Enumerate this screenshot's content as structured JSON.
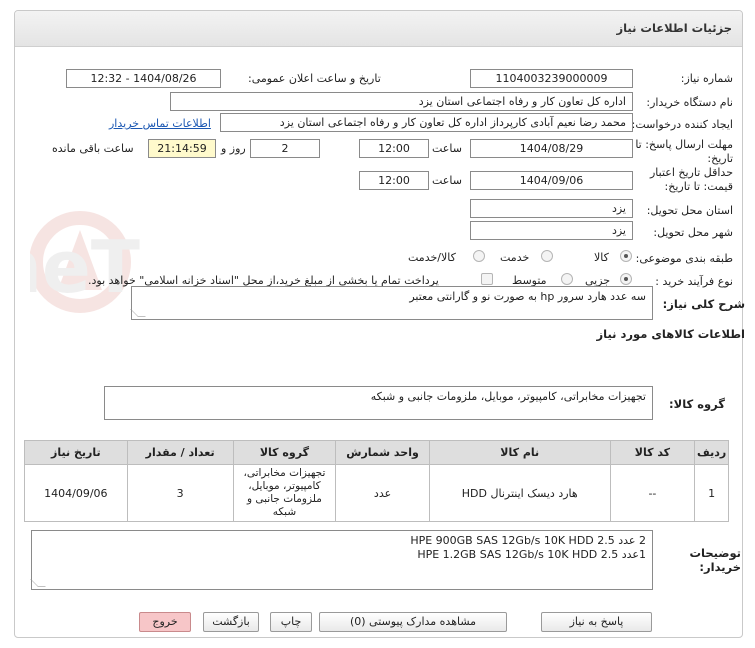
{
  "panel": {
    "title": "جزئیات اطلاعات نیاز"
  },
  "fields": {
    "need_number_label": "شماره نیاز:",
    "need_number": "1104003239000009",
    "announce_label": "تاریخ و ساعت اعلان عمومی:",
    "announce_value": "1404/08/26 - 12:32",
    "buyer_org_label": "نام دستگاه خریدار:",
    "buyer_org": "اداره کل تعاون  کار و رفاه اجتماعی استان یزد",
    "creator_label": "ایجاد کننده درخواست:",
    "creator": "محمد رضا  نعیم آبادی کارپرداز اداره کل تعاون  کار و رفاه اجتماعی استان یزد",
    "contact_link": "اطلاعات تماس خریدار",
    "deadline_label_1": "مهلت ارسال پاسخ: تا",
    "deadline_label_2": "تاریخ:",
    "deadline_date": "1404/08/29",
    "time_label": "ساعت",
    "deadline_time": "12:00",
    "days_value": "2",
    "days_label": "روز و",
    "remaining_time": "21:14:59",
    "remaining_label": "ساعت باقی مانده",
    "validity_label_1": "حداقل تاریخ اعتبار",
    "validity_label_2": "قیمت: تا تاریخ:",
    "validity_date": "1404/09/06",
    "validity_time": "12:00",
    "province_label": "استان محل تحویل:",
    "province": "یزد",
    "city_label": "شهر محل تحویل:",
    "city": "یزد",
    "category_label": "طبقه بندی موضوعی:",
    "category_options": [
      "کالا",
      "خدمت",
      "کالا/خدمت"
    ],
    "category_selected": "کالا",
    "process_label": "نوع فرآیند خرید :",
    "process_options": [
      "جزیی",
      "متوسط"
    ],
    "payment_note": "پرداخت تمام یا بخشی از مبلغ خرید،از محل \"اسناد خزانه اسلامی\" خواهد بود."
  },
  "summary": {
    "label": "شرح کلی نیاز:",
    "text": "سه عدد هارد سرور hp به صورت نو و گارانتی معتبر"
  },
  "goods": {
    "section_title": "اطلاعات کالاهای مورد نیاز",
    "group_label": "گروه کالا:",
    "group_value": "تجهیزات مخابراتی، کامپیوتر، موبایل، ملزومات جانبی و شبکه"
  },
  "table": {
    "headers": [
      "ردیف",
      "کد کالا",
      "نام کالا",
      "واحد شمارش",
      "گروه کالا",
      "تعداد / مقدار",
      "تاریخ نیاز"
    ],
    "rows": [
      {
        "index": "1",
        "code": "--",
        "name": "هارد دیسک اینترنال HDD",
        "unit": "عدد",
        "group": "تجهیزات مخابراتی، کامپیوتر، موبایل، ملزومات جانبی و شبکه",
        "qty": "3",
        "date": "1404/09/06"
      }
    ]
  },
  "buyer_notes": {
    "label_1": "توضیحات",
    "label_2": "خریدار:",
    "line_1": "2 عدد HPE 900GB SAS 12Gb/s  10K HDD 2.5",
    "line_2": "1عدد HPE 1.2GB SAS 12Gb/s 10K HDD 2.5"
  },
  "buttons": {
    "reply": "پاسخ به نیاز",
    "attachments": "مشاهده مدارک پیوستی (0)",
    "print": "چاپ",
    "back": "بازگشت",
    "exit": "خروج"
  },
  "watermark_text": "AriaTender.neT"
}
